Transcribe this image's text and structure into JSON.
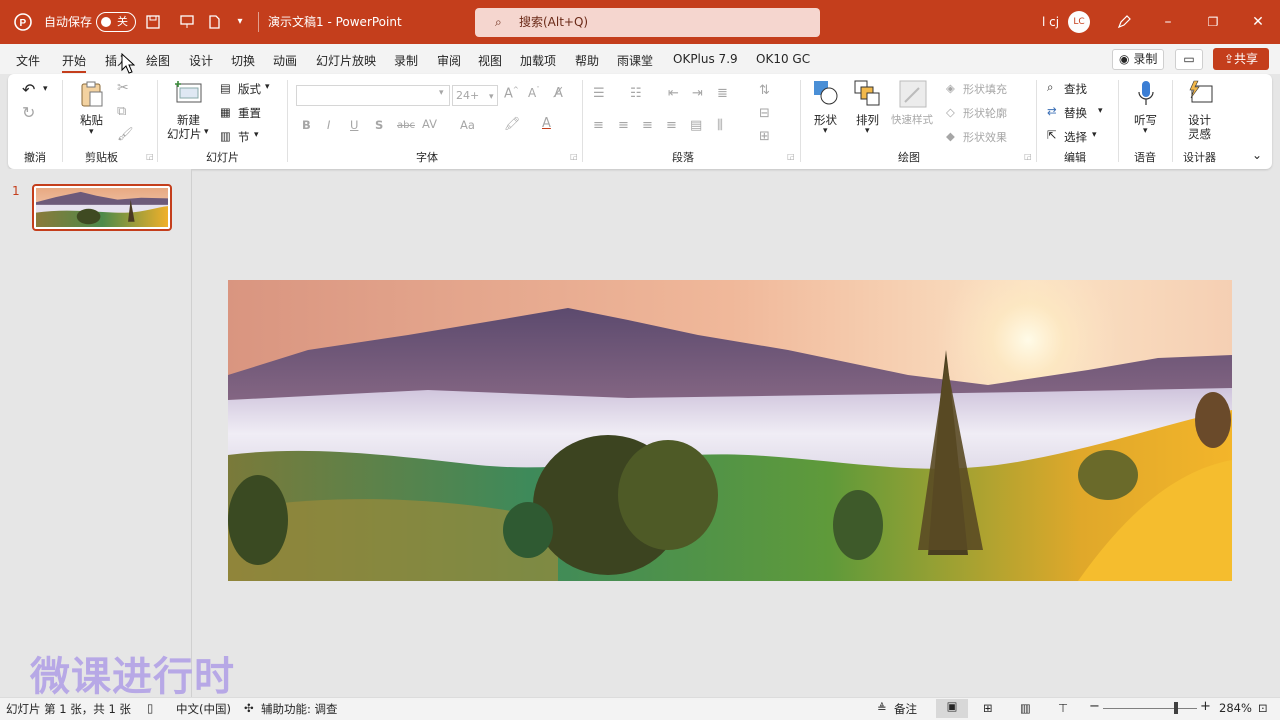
{
  "titlebar": {
    "autosave_label": "自动保存",
    "autosave_state": "关",
    "doc_title": "演示文稿1 - PowerPoint",
    "search_placeholder": "搜索(Alt+Q)",
    "user_name": "l cj",
    "user_initials": "LC"
  },
  "menubar": {
    "tabs": [
      "文件",
      "开始",
      "插入",
      "绘图",
      "设计",
      "切换",
      "动画",
      "幻灯片放映",
      "录制",
      "审阅",
      "视图",
      "加载项",
      "帮助",
      "雨课堂",
      "OKPlus 7.9",
      "OK10 GC"
    ],
    "active_tab": "开始",
    "record_label": "录制",
    "share_label": "共享"
  },
  "ribbon": {
    "groups": {
      "undo": "撤消",
      "clipboard": "剪贴板",
      "slides": "幻灯片",
      "font": "字体",
      "paragraph": "段落",
      "drawing": "绘图",
      "editing": "编辑",
      "voice": "语音",
      "designer": "设计器"
    },
    "clipboard": {
      "paste": "粘贴"
    },
    "slides": {
      "new_slide_1": "新建",
      "new_slide_2": "幻灯片",
      "layout": "版式",
      "reset": "重置",
      "section": "节"
    },
    "font": {
      "size_placeholder": "24+",
      "bold": "B",
      "italic": "I",
      "underline": "U",
      "shadow": "S",
      "strike": "abc",
      "spacing": "AV",
      "case": "Aa",
      "color": "A"
    },
    "drawing": {
      "shapes": "形状",
      "arrange": "排列",
      "quick_styles": "快速样式",
      "fill": "形状填充",
      "outline": "形状轮廓",
      "effects": "形状效果"
    },
    "editing": {
      "find": "查找",
      "replace": "替换",
      "select": "选择"
    },
    "voice": {
      "dictate": "听写"
    },
    "designer": {
      "ideas_1": "设计",
      "ideas_2": "灵感"
    }
  },
  "thumbnails": {
    "slide_number": "1"
  },
  "statusbar": {
    "slide_info": "幻灯片 第 1 张，共 1 张",
    "language": "中文(中国)",
    "accessibility": "辅助功能: 调查",
    "notes": "备注",
    "zoom": "284%"
  },
  "watermark": {
    "text": "微课进行时"
  },
  "colors": {
    "accent": "#c43e1c",
    "ribbon_bg": "#ffffff",
    "canvas_bg": "#e6e6e6",
    "watermark": "#b7a8e6"
  }
}
